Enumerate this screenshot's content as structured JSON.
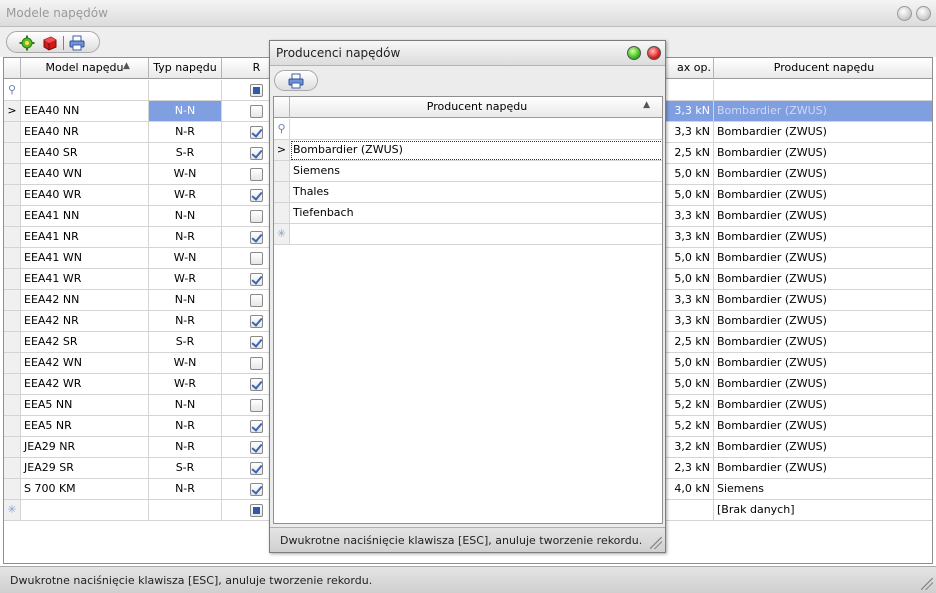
{
  "main": {
    "title": "Modele napędów",
    "toolbar": {
      "icons": [
        "gear-icon",
        "red-box-icon",
        "printer-icon"
      ]
    },
    "columns": {
      "model": "Model napędu",
      "typ": "Typ napędu",
      "r": "R",
      "maxop": "ax op.",
      "producent": "Producent napędu"
    },
    "sort_indicator": "▲",
    "rows": [
      {
        "model": "EEA40 NN",
        "typ": "N-N",
        "r": false,
        "maxop": "3,3 kN",
        "producent": "Bombardier (ZWUS)"
      },
      {
        "model": "EEA40 NR",
        "typ": "N-R",
        "r": true,
        "maxop": "3,3 kN",
        "producent": "Bombardier (ZWUS)"
      },
      {
        "model": "EEA40 SR",
        "typ": "S-R",
        "r": true,
        "maxop": "2,5 kN",
        "producent": "Bombardier (ZWUS)"
      },
      {
        "model": "EEA40 WN",
        "typ": "W-N",
        "r": false,
        "maxop": "5,0 kN",
        "producent": "Bombardier (ZWUS)"
      },
      {
        "model": "EEA40 WR",
        "typ": "W-R",
        "r": true,
        "maxop": "5,0 kN",
        "producent": "Bombardier (ZWUS)"
      },
      {
        "model": "EEA41 NN",
        "typ": "N-N",
        "r": false,
        "maxop": "3,3 kN",
        "producent": "Bombardier (ZWUS)"
      },
      {
        "model": "EEA41 NR",
        "typ": "N-R",
        "r": true,
        "maxop": "3,3 kN",
        "producent": "Bombardier (ZWUS)"
      },
      {
        "model": "EEA41 WN",
        "typ": "W-N",
        "r": false,
        "maxop": "5,0 kN",
        "producent": "Bombardier (ZWUS)"
      },
      {
        "model": "EEA41 WR",
        "typ": "W-R",
        "r": true,
        "maxop": "5,0 kN",
        "producent": "Bombardier (ZWUS)"
      },
      {
        "model": "EEA42 NN",
        "typ": "N-N",
        "r": false,
        "maxop": "3,3 kN",
        "producent": "Bombardier (ZWUS)"
      },
      {
        "model": "EEA42 NR",
        "typ": "N-R",
        "r": true,
        "maxop": "3,3 kN",
        "producent": "Bombardier (ZWUS)"
      },
      {
        "model": "EEA42 SR",
        "typ": "S-R",
        "r": true,
        "maxop": "2,5 kN",
        "producent": "Bombardier (ZWUS)"
      },
      {
        "model": "EEA42 WN",
        "typ": "W-N",
        "r": false,
        "maxop": "5,0 kN",
        "producent": "Bombardier (ZWUS)"
      },
      {
        "model": "EEA42 WR",
        "typ": "W-R",
        "r": true,
        "maxop": "5,0 kN",
        "producent": "Bombardier (ZWUS)"
      },
      {
        "model": "EEA5 NN",
        "typ": "N-N",
        "r": false,
        "maxop": "5,2 kN",
        "producent": "Bombardier (ZWUS)"
      },
      {
        "model": "EEA5 NR",
        "typ": "N-R",
        "r": true,
        "maxop": "5,2 kN",
        "producent": "Bombardier (ZWUS)"
      },
      {
        "model": "JEA29 NR",
        "typ": "N-R",
        "r": true,
        "maxop": "3,2 kN",
        "producent": "Bombardier (ZWUS)"
      },
      {
        "model": "JEA29 SR",
        "typ": "S-R",
        "r": true,
        "maxop": "2,3 kN",
        "producent": "Bombardier (ZWUS)"
      },
      {
        "model": "S 700 KM",
        "typ": "N-R",
        "r": true,
        "maxop": "4,0 kN",
        "producent": "Siemens"
      }
    ],
    "new_row_producent": "[Brak danych]",
    "status": "Dwukrotne naciśnięcie klawisza [ESC], anuluje tworzenie rekordu."
  },
  "dialog": {
    "title": "Producenci napędów",
    "column": "Producent napędu",
    "sort_indicator": "▲",
    "rows": [
      "Bombardier (ZWUS)",
      "Siemens",
      "Thales",
      "Tiefenbach"
    ],
    "status": "Dwukrotne naciśnięcie klawisza [ESC], anuluje tworzenie rekordu."
  },
  "glyphs": {
    "current_row": ">",
    "filter": "⚲",
    "new_row": "✳"
  },
  "colors": {
    "selection": "#7f9fe0",
    "checkbox_mark": "#3b65b5"
  }
}
